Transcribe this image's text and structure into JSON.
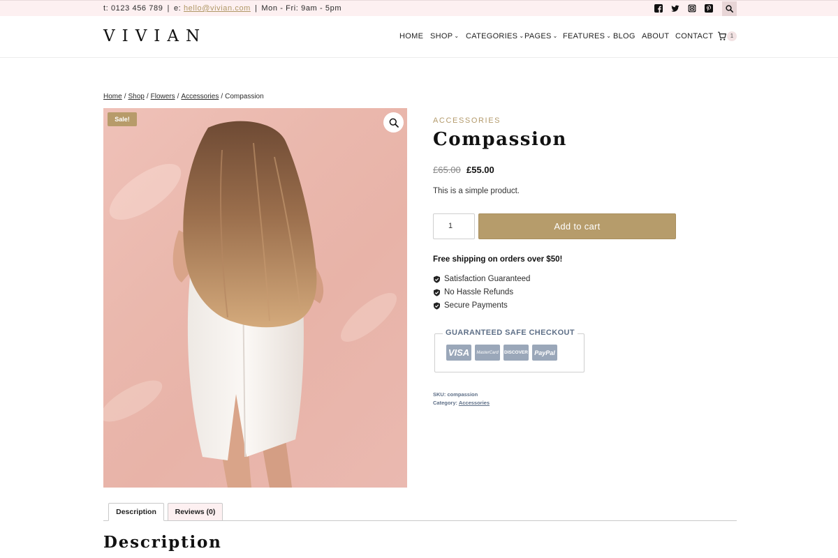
{
  "topbar": {
    "phone": "t: 0123 456 789",
    "email_prefix": "e:",
    "email": "hello@vivian.com",
    "hours": "Mon - Fri: 9am - 5pm",
    "separator": "|",
    "social_icons": [
      "facebook-icon",
      "twitter-icon",
      "instagram-icon",
      "pinterest-icon"
    ],
    "search_icon": "search-icon"
  },
  "header": {
    "logo": "VIVIAN",
    "nav": [
      {
        "label": "HOME",
        "dropdown": false
      },
      {
        "label": "SHOP",
        "dropdown": true
      },
      {
        "label": "CATEGORIES",
        "dropdown": true
      },
      {
        "label": "PAGES",
        "dropdown": true
      },
      {
        "label": "FEATURES",
        "dropdown": true
      },
      {
        "label": "BLOG",
        "dropdown": false
      },
      {
        "label": "ABOUT",
        "dropdown": false
      },
      {
        "label": "CONTACT",
        "dropdown": false
      }
    ],
    "cart_count": "1"
  },
  "breadcrumb": {
    "items": [
      "Home",
      "Shop",
      "Flowers",
      "Accessories"
    ],
    "current": "Compassion",
    "separator": "/"
  },
  "product": {
    "sale_badge": "Sale!",
    "category": "ACCESSORIES",
    "title": "Compassion",
    "price_old": "£65.00",
    "price_new": "£55.00",
    "short_description": "This is a simple product.",
    "quantity": "1",
    "add_to_cart": "Add to cart",
    "shipping_note": "Free shipping on orders over $50!",
    "features": [
      "Satisfaction Guaranteed",
      "No Hassle Refunds",
      "Secure Payments"
    ],
    "checkout_title": "GUARANTEED SAFE CHECKOUT",
    "payment_cards": [
      "VISA",
      "MasterCard",
      "DISCOVER",
      "PayPal"
    ],
    "sku_label": "SKU:",
    "sku": "compassion",
    "category_label": "Category:",
    "category_link": "Accessories"
  },
  "tabs": [
    {
      "label": "Description",
      "active": true
    },
    {
      "label": "Reviews (0)",
      "active": false
    }
  ],
  "description_heading": "Description",
  "colors": {
    "topbar_bg": "#fdf0f1",
    "accent_gold": "#b69c6b",
    "meta_blue": "#5e6f87",
    "card_gray": "#9aa7b9"
  }
}
